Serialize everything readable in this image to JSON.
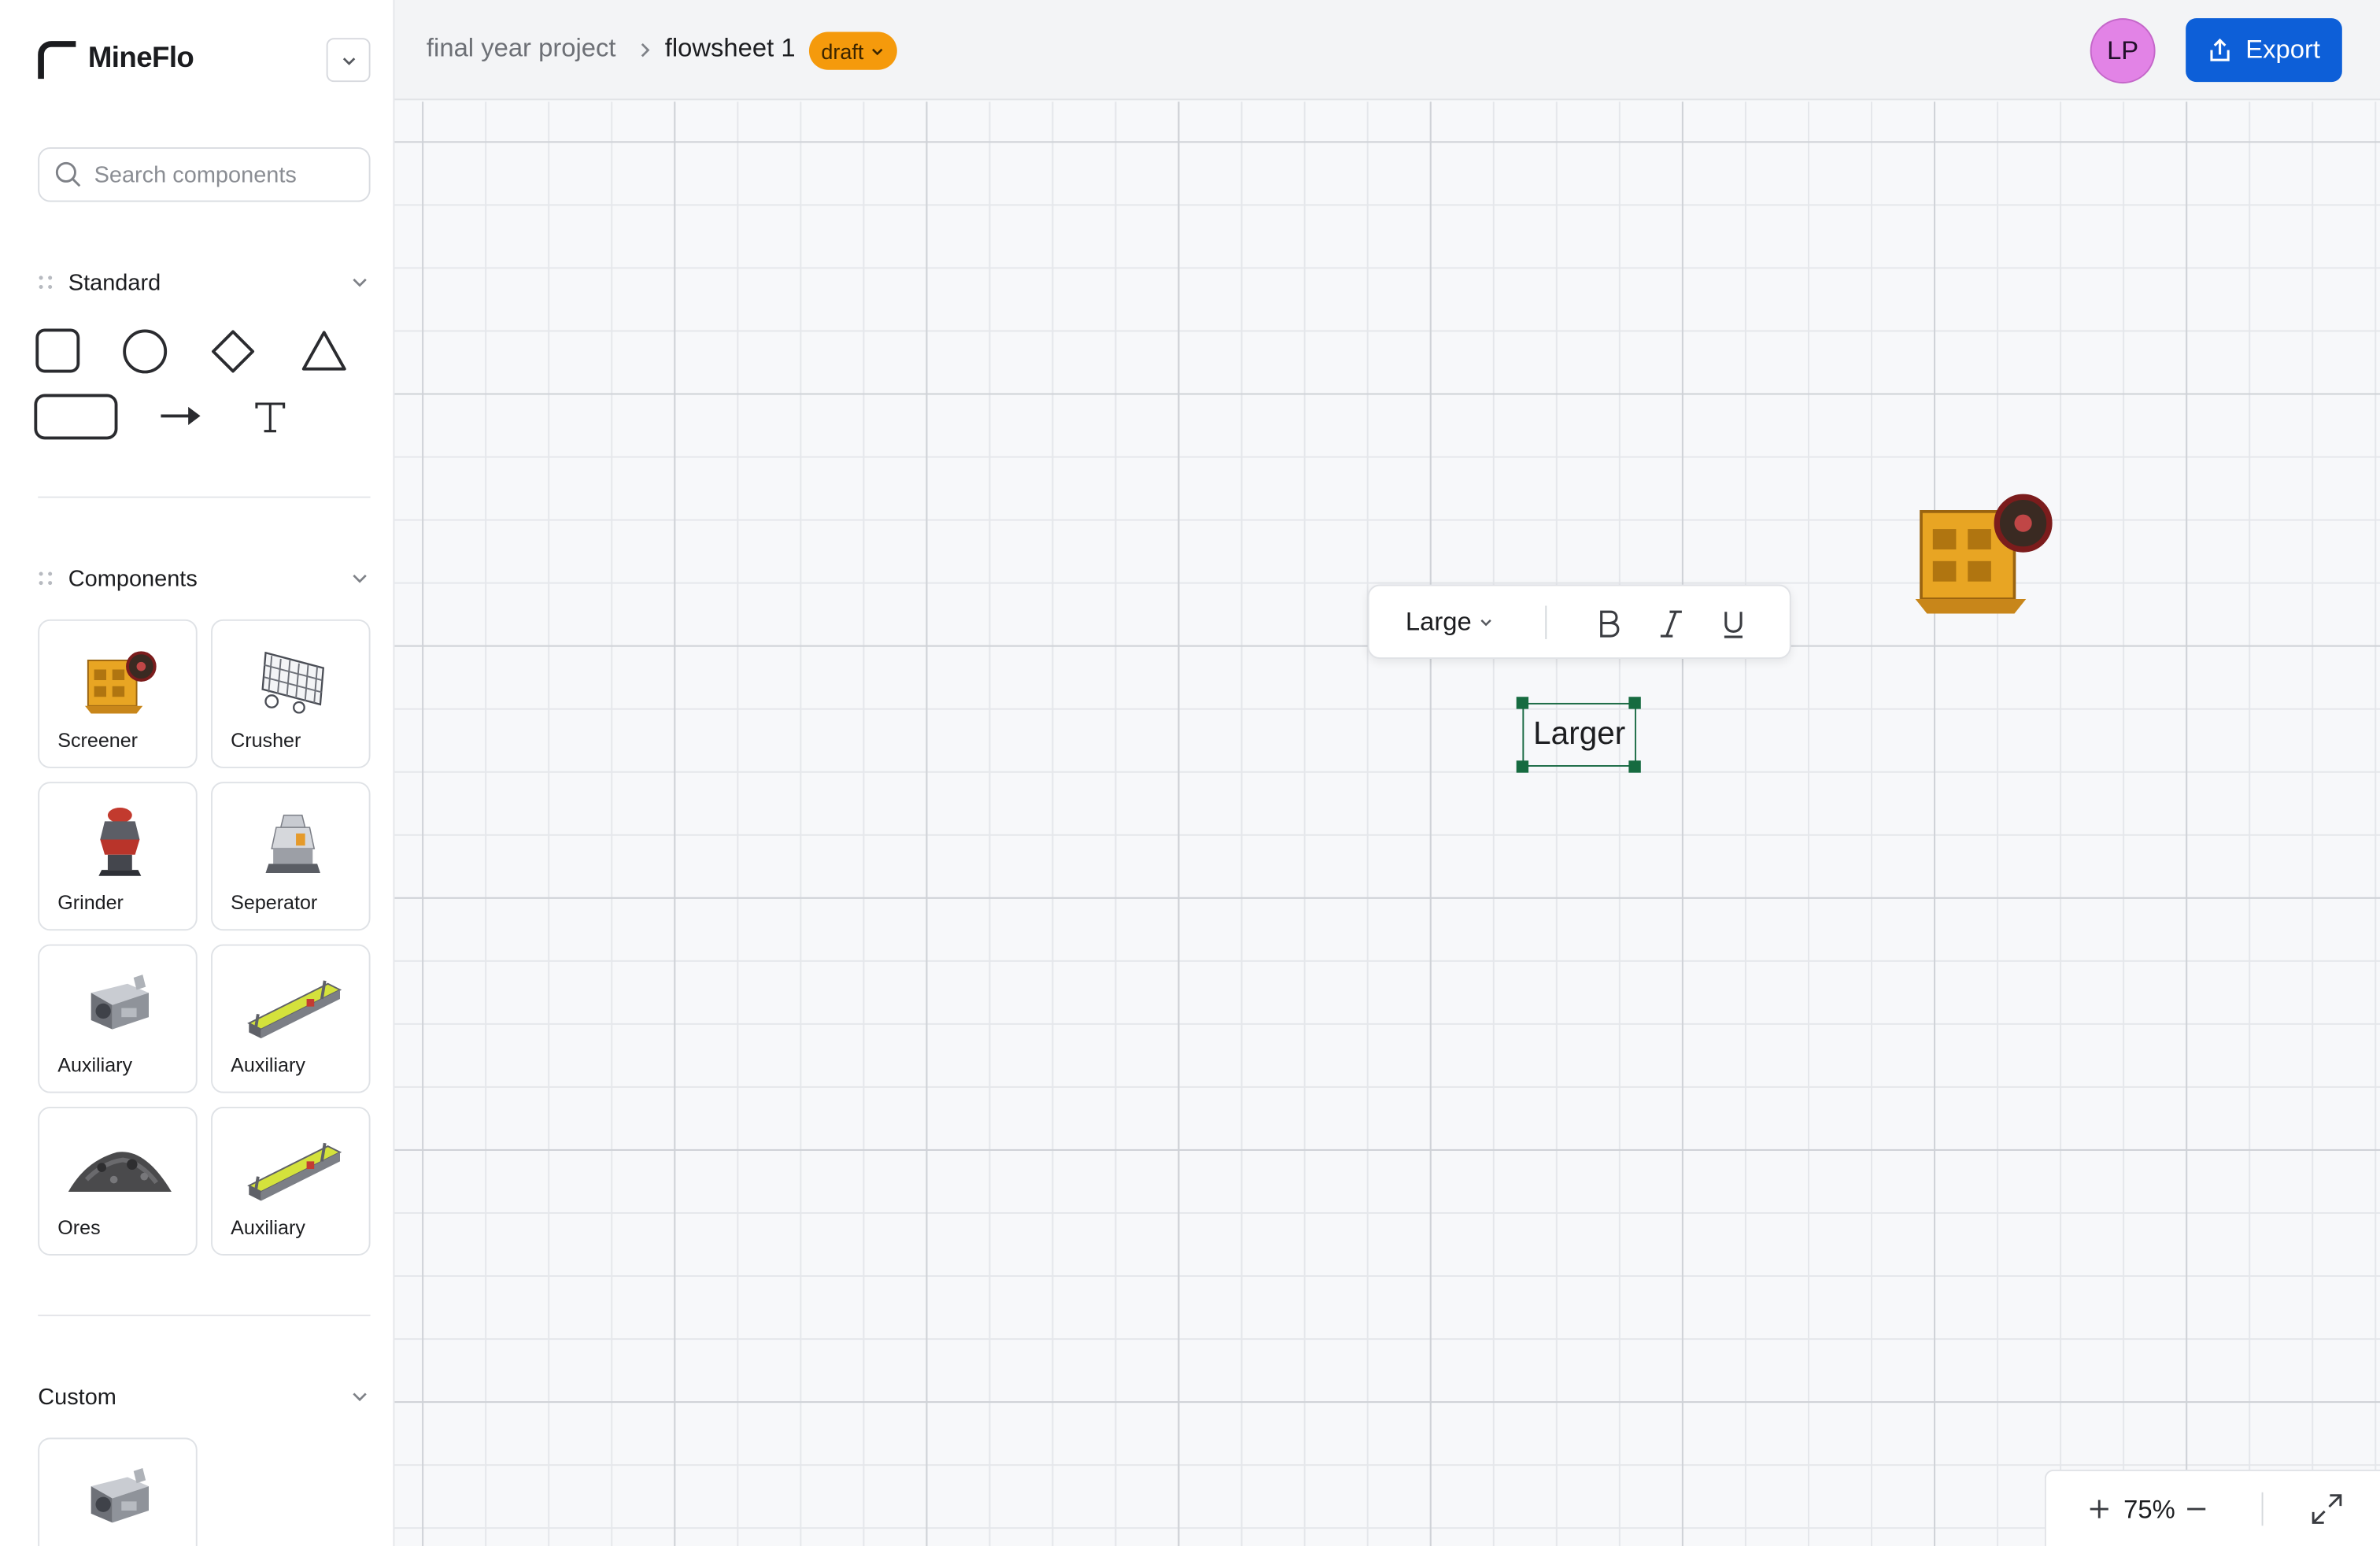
{
  "app": {
    "name": "MineFlo"
  },
  "sidebar": {
    "search": {
      "placeholder": "Search components",
      "value": ""
    },
    "standard": {
      "title": "Standard",
      "shapes": [
        "rounded-square-icon",
        "circle-icon",
        "diamond-icon",
        "triangle-icon",
        "rounded-rectangle-icon",
        "arrow-right-icon",
        "text-tool-icon"
      ]
    },
    "components": {
      "title": "Components",
      "items": [
        {
          "label": "Screener",
          "icon": "jaw-crusher-icon"
        },
        {
          "label": "Crusher",
          "icon": "screen-wire-icon"
        },
        {
          "label": "Grinder",
          "icon": "cone-grinder-icon"
        },
        {
          "label": "Seperator",
          "icon": "separator-machine-icon"
        },
        {
          "label": "Auxiliary",
          "icon": "crusher-machine-icon"
        },
        {
          "label": "Auxiliary",
          "icon": "vibrating-screen-icon"
        },
        {
          "label": "Ores",
          "icon": "ore-pile-icon"
        },
        {
          "label": "Auxiliary",
          "icon": "vibrating-screen-icon"
        }
      ]
    },
    "custom": {
      "title": "Custom",
      "items": [
        {
          "label": "",
          "icon": "crusher-machine-icon"
        }
      ]
    }
  },
  "header": {
    "breadcrumb": {
      "project": "final year project",
      "sheet": "flowsheet 1"
    },
    "status_badge": "draft",
    "avatar_initials": "LP",
    "export_label": "Export"
  },
  "canvas": {
    "text_toolbar": {
      "font_size": "Large",
      "buttons": [
        "bold-icon",
        "italic-icon",
        "underline-icon"
      ]
    },
    "text_element": "Larger",
    "placed_component_icon": "jaw-crusher-icon",
    "zoom": "75%"
  },
  "colors": {
    "accent": "#0d5fd8",
    "draft_badge": "#f59a0c",
    "avatar": "#e283e6",
    "selection": "#166b40"
  }
}
